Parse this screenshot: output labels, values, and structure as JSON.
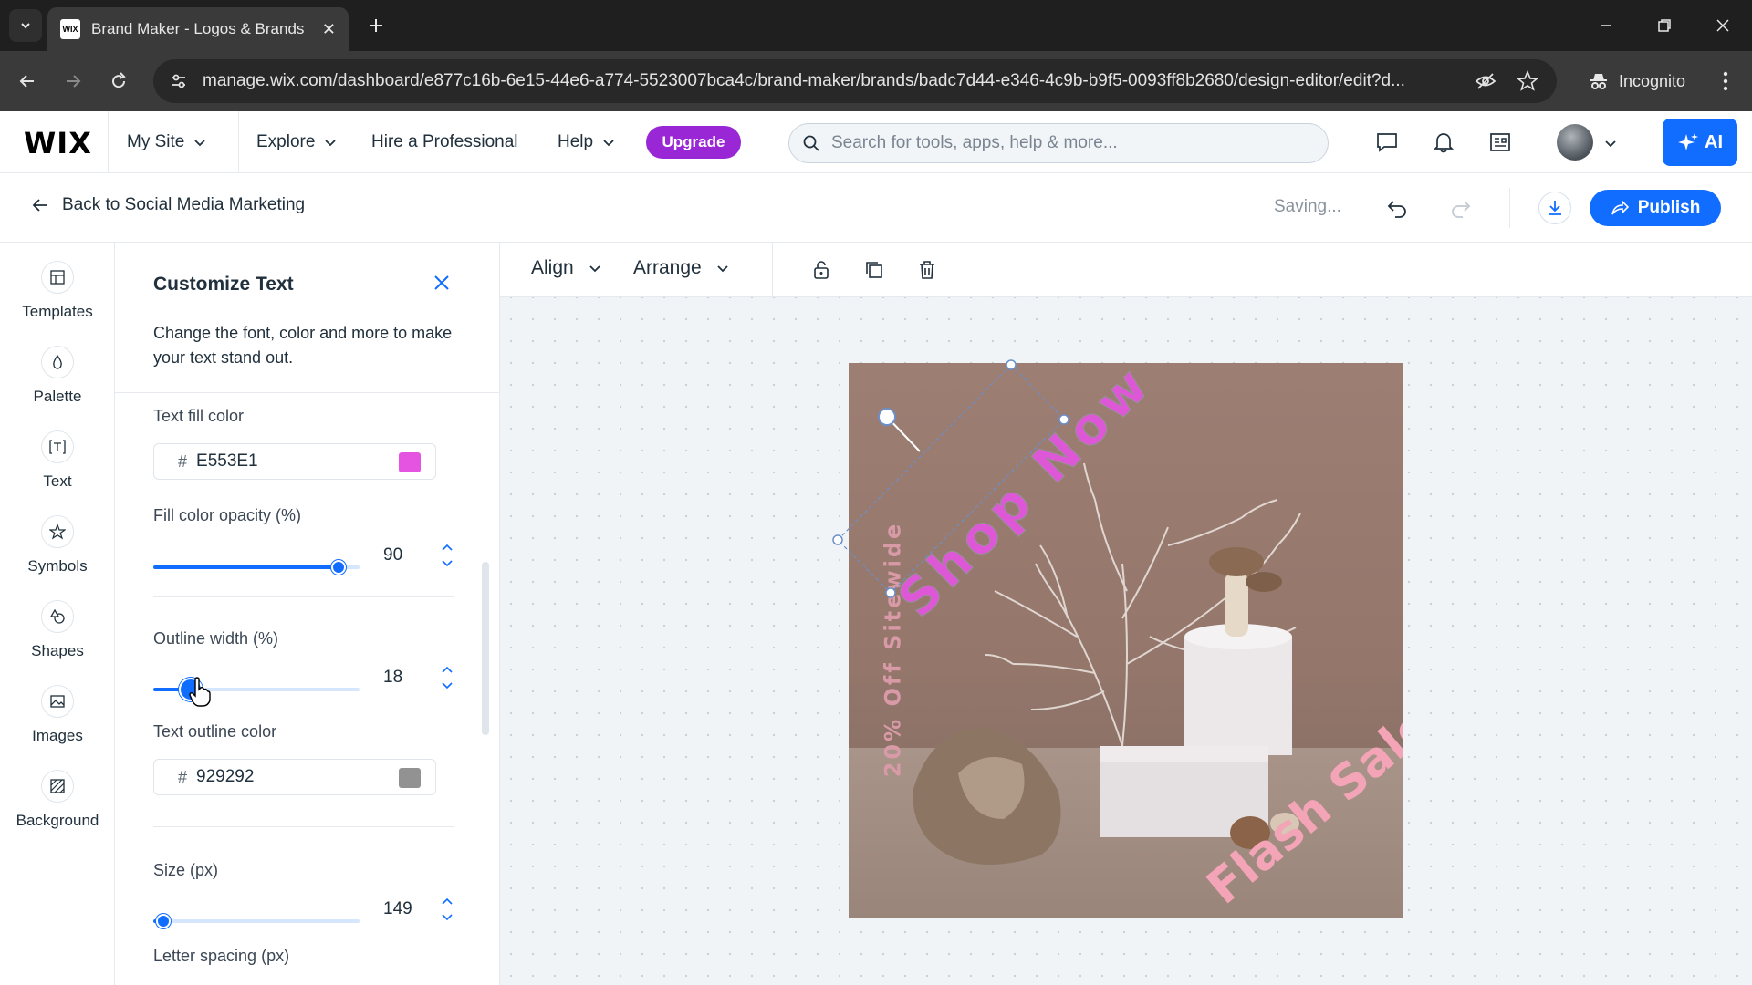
{
  "browser": {
    "tab_title": "Brand Maker - Logos & Brands",
    "favicon_text": "WIX",
    "url": "manage.wix.com/dashboard/e877c16b-6e15-44e6-a774-5523007bca4c/brand-maker/brands/badc7d44-e346-4c9b-b9f5-0093ff8b2680/design-editor/edit?d...",
    "incognito_label": "Incognito"
  },
  "wix": {
    "logo": "WIX",
    "site_label": "My Site",
    "nav": [
      "Explore",
      "Hire a Professional",
      "Help"
    ],
    "upgrade_label": "Upgrade",
    "search_placeholder": "Search for tools, apps, help & more...",
    "ai_label": "AI"
  },
  "editor_header": {
    "back_label": "Back to Social Media Marketing",
    "status": "Saving...",
    "publish_label": "Publish"
  },
  "rail": {
    "items": [
      {
        "label": "Templates",
        "icon": "templates-icon"
      },
      {
        "label": "Palette",
        "icon": "palette-icon"
      },
      {
        "label": "Text",
        "icon": "text-icon"
      },
      {
        "label": "Symbols",
        "icon": "star-icon"
      },
      {
        "label": "Shapes",
        "icon": "shapes-icon"
      },
      {
        "label": "Images",
        "icon": "image-icon"
      },
      {
        "label": "Background",
        "icon": "background-icon"
      }
    ]
  },
  "panel": {
    "title": "Customize Text",
    "description": "Change the font, color and more to make your text stand out.",
    "fill_color_label": "Text fill color",
    "fill_color_value": "E553E1",
    "fill_color_hex": "#E553E1",
    "opacity_label": "Fill color opacity (%)",
    "opacity_value": "90",
    "opacity_fraction": 0.9,
    "outline_width_label": "Outline width (%)",
    "outline_width_value": "18",
    "outline_fraction": 0.18,
    "outline_color_label": "Text outline color",
    "outline_color_value": "929292",
    "outline_color_hex": "#929292",
    "size_label": "Size (px)",
    "size_value": "149",
    "size_fraction": 0.05,
    "letter_spacing_label": "Letter spacing (px)"
  },
  "toolbar": {
    "align_label": "Align",
    "arrange_label": "Arrange"
  },
  "artboard": {
    "shop_now": "Shop Now",
    "discount": "20% Off Sitewide",
    "flash_sale": "Flash Sale"
  },
  "colors": {
    "accent": "#116DFF",
    "upgrade": "#9A27D5"
  }
}
